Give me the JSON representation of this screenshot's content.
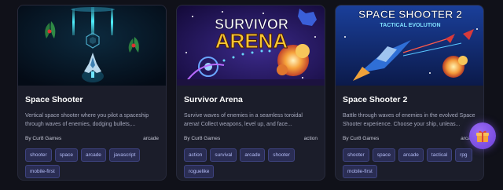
{
  "games": [
    {
      "title": "Space Shooter",
      "description": "Vertical space shooter where you pilot a spaceship through waves of enemies, dodging bullets,...",
      "author": "By Cur8 Games",
      "category": "arcade",
      "tags": [
        "shooter",
        "space",
        "arcade",
        "javascript",
        "mobile-first"
      ]
    },
    {
      "title": "Survivor Arena",
      "thumb_text": [
        "SURVIVOR",
        "ARENA"
      ],
      "description": "Survive waves of enemies in a seamless toroidal arena! Collect weapons, level up, and face...",
      "author": "By Cur8 Games",
      "category": "action",
      "tags": [
        "action",
        "survival",
        "arcade",
        "shooter",
        "roguelike"
      ]
    },
    {
      "title": "Space Shooter 2",
      "thumb_text": [
        "SPACE SHOOTER 2",
        "TACTICAL EVOLUTION"
      ],
      "description": "Battle through waves of enemies in the evolved Space Shooter experience. Choose your ship, unleas...",
      "author": "By Cur8 Games",
      "category": "arcade",
      "tags": [
        "shooter",
        "space",
        "arcade",
        "tactical",
        "rpg",
        "mobile-first"
      ]
    }
  ],
  "gift_button": {
    "icon": "gift-icon"
  },
  "colors": {
    "background": "#101119",
    "card": "#1b1d2a",
    "tag_bg": "#2a2d53",
    "tag_text": "#b4bcf6",
    "accent_gift": "#7c4ee6"
  }
}
